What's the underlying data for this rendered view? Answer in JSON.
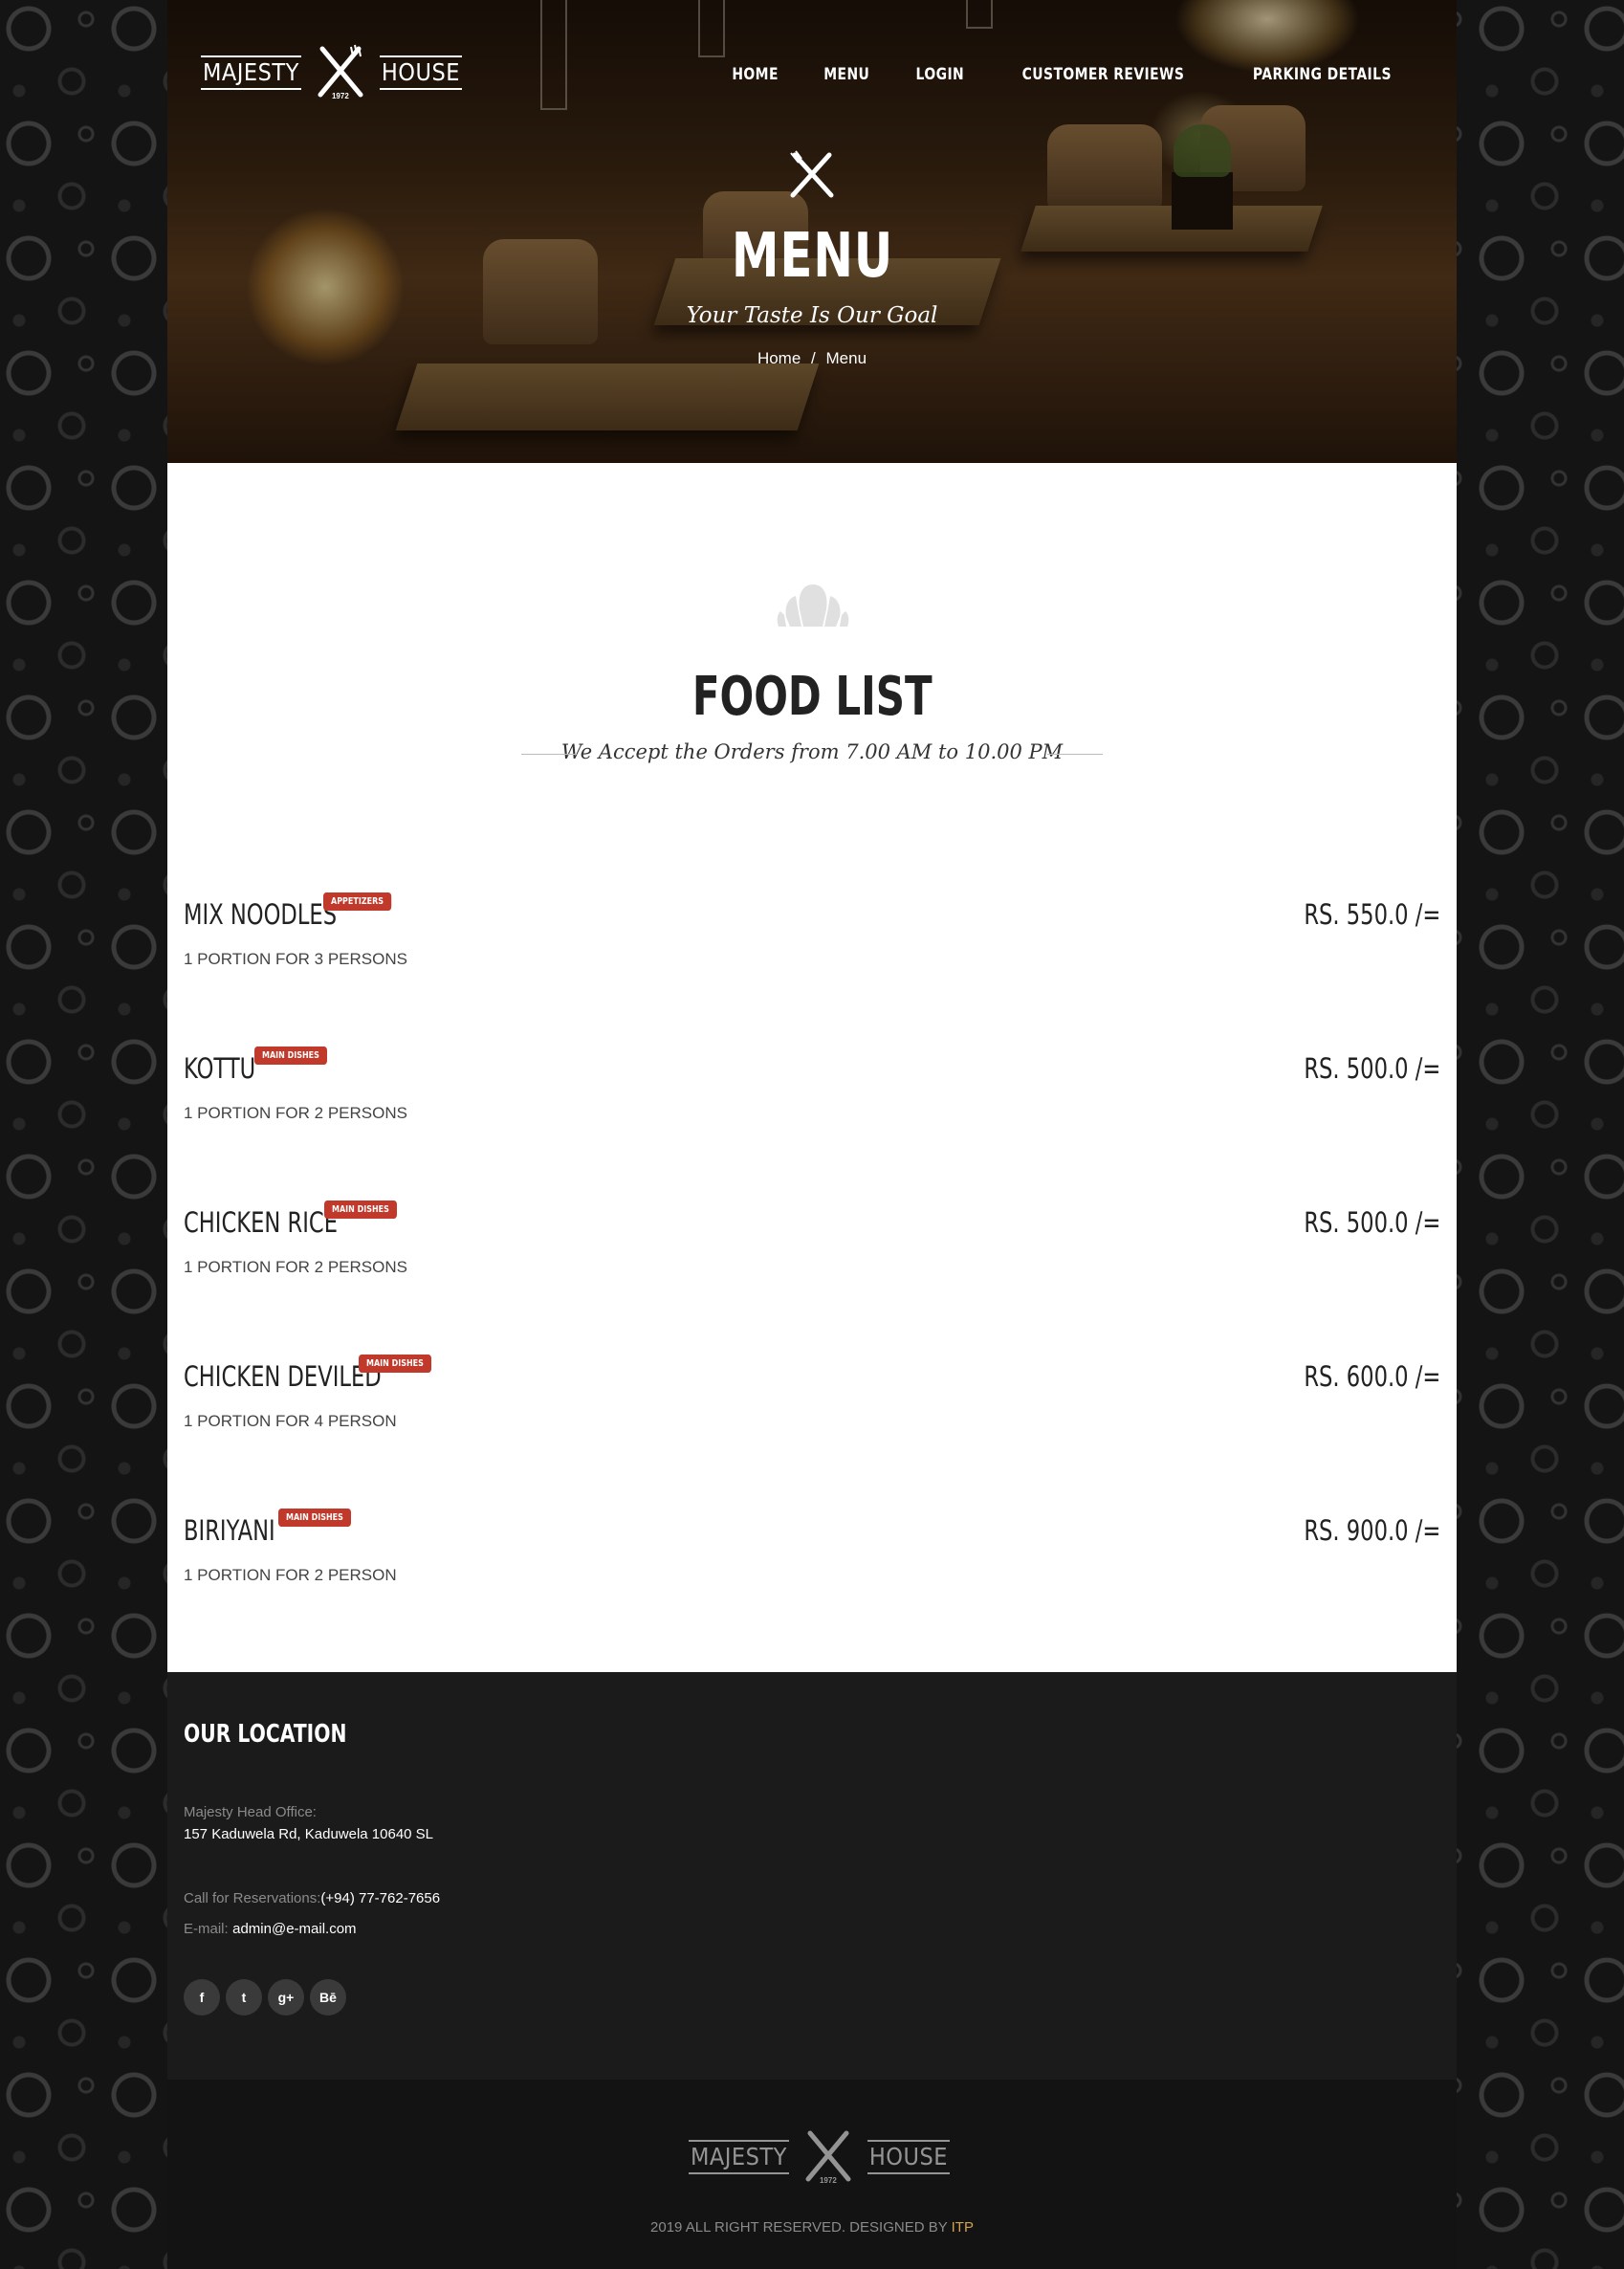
{
  "logo": {
    "left": "MAJESTY",
    "right": "HOUSE",
    "year": "1972"
  },
  "nav": [
    "HOME",
    "MENU",
    "LOGIN",
    "CUSTOMER REVIEWS",
    "PARKING DETAILS"
  ],
  "hero": {
    "title": "MENU",
    "subtitle": "Your Taste Is Our Goal",
    "breadcrumb": {
      "home": "Home",
      "separator": "/",
      "current": "Menu"
    }
  },
  "section": {
    "title": "FOOD LIST",
    "subtitle": "We Accept the Orders from 7.00 AM to 10.00 PM"
  },
  "menu_items": [
    {
      "name": "MIX NOODLES",
      "badge": "APPETIZERS",
      "price": "RS. 550.0 /=",
      "desc": "1 PORTION FOR 3 PERSONS"
    },
    {
      "name": "KOTTU",
      "badge": "MAIN DISHES",
      "price": "RS. 500.0 /=",
      "desc": "1 PORTION FOR 2 PERSONS"
    },
    {
      "name": "CHICKEN RICE",
      "badge": "MAIN DISHES",
      "price": "RS. 500.0 /=",
      "desc": "1 PORTION FOR 2 PERSONS"
    },
    {
      "name": "CHICKEN DEVILED",
      "badge": "MAIN DISHES",
      "price": "RS. 600.0 /=",
      "desc": "1 PORTION FOR 4 PERSON"
    },
    {
      "name": "BIRIYANI",
      "badge": "MAIN DISHES",
      "price": "RS. 900.0 /=",
      "desc": "1 PORTION FOR 2 PERSON"
    }
  ],
  "footer": {
    "location_title": "OUR LOCATION",
    "office_label": "Majesty Head Office:",
    "office_address": "157 Kaduwela Rd, Kaduwela 10640 SL",
    "reservation_label": "Call for Reservations:",
    "reservation_phone": "(+94) 77-762-7656",
    "email_label": "E-mail:",
    "email": "admin@e-mail.com",
    "social": [
      "f",
      "t",
      "g+",
      "Bē"
    ],
    "copyright": "2019 ALL RIGHT RESERVED. DESIGNED BY",
    "designer": "ITP"
  },
  "colors": {
    "badge": "#c0392b",
    "accent": "#d4a24a",
    "footer_bg": "#1b1b1b"
  }
}
